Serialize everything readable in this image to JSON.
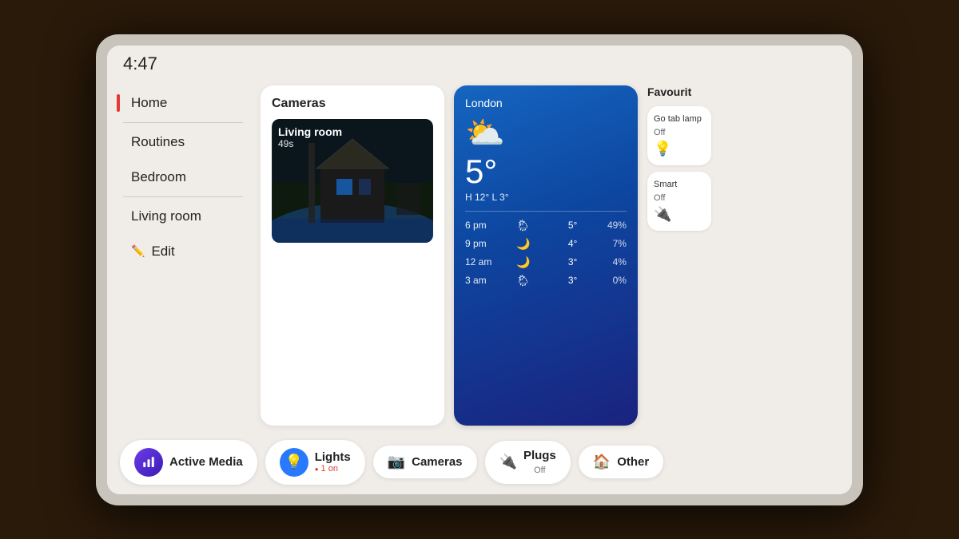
{
  "statusBar": {
    "time": "4:47"
  },
  "sidebar": {
    "items": [
      {
        "label": "Home",
        "active": true
      },
      {
        "label": "Routines",
        "active": false
      },
      {
        "label": "Bedroom",
        "active": false
      },
      {
        "label": "Living room",
        "active": false
      }
    ],
    "editLabel": "Edit"
  },
  "cameraCard": {
    "title": "Cameras",
    "roomName": "Living room",
    "duration": "49s"
  },
  "weatherCard": {
    "city": "London",
    "temperature": "5°",
    "highLow": "H 12°  L 3°",
    "forecast": [
      {
        "hour": "6 pm",
        "icon": "🌦",
        "temp": "5°",
        "precip": "49%"
      },
      {
        "hour": "9 pm",
        "icon": "🌙",
        "temp": "4°",
        "precip": "7%"
      },
      {
        "hour": "12 am",
        "icon": "🌙",
        "temp": "3°",
        "precip": "4%"
      },
      {
        "hour": "3 am",
        "icon": "🌦",
        "temp": "3°",
        "precip": "0%"
      }
    ]
  },
  "favorites": {
    "title": "Favourit",
    "items": [
      {
        "label": "Go tab lamp",
        "status": "Off",
        "icon": "💡"
      },
      {
        "label": "Smart",
        "status": "Off",
        "icon": "🔌"
      }
    ]
  },
  "bottomBar": {
    "buttons": [
      {
        "type": "active-media",
        "label": "Active Media",
        "iconType": "purple",
        "iconSymbol": "📊"
      },
      {
        "type": "lights",
        "label": "Lights",
        "sublabel": "1 on",
        "iconType": "blue",
        "iconSymbol": "💡"
      },
      {
        "type": "cameras",
        "label": "Cameras",
        "iconType": "gray",
        "iconSymbol": "📷"
      },
      {
        "type": "plugs",
        "label": "Plugs",
        "status": "Off",
        "iconSymbol": "🔌"
      },
      {
        "type": "other",
        "label": "Other",
        "iconSymbol": "🏠"
      }
    ]
  }
}
